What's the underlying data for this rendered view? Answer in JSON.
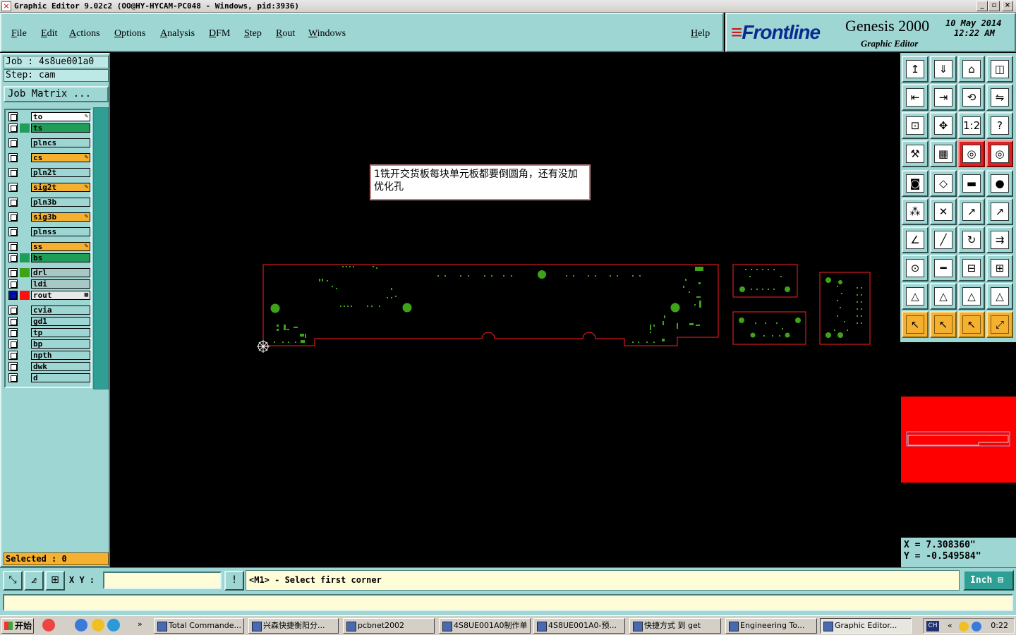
{
  "window": {
    "title": "Graphic Editor 9.02c2  (OO@HY-HYCAM-PC048 - Windows, pid:3936)"
  },
  "menu": {
    "items": [
      "File",
      "Edit",
      "Actions",
      "Options",
      "Analysis",
      "DFM",
      "Step",
      "Rout",
      "Windows"
    ],
    "help": "Help"
  },
  "brand": {
    "logo": "Frontline",
    "product": "Genesis 2000",
    "subtitle": "Graphic Editor",
    "date": "10 May 2014",
    "time": "12:22 AM"
  },
  "job": {
    "job_label": "Job : 4s8ue001a0",
    "step_label": "Step: cam",
    "matrix_button": "Job Matrix ..."
  },
  "layers": [
    {
      "name": "to",
      "color": "#ffffff",
      "marker": "✎"
    },
    {
      "name": "ts",
      "color": "#1f9e58",
      "marker": ""
    },
    {
      "name": "plncs",
      "color": "#9ed6d3",
      "marker": ""
    },
    {
      "name": "cs",
      "color": "#f5b030",
      "marker": "✎"
    },
    {
      "name": "pln2t",
      "color": "#9ed6d3",
      "marker": ""
    },
    {
      "name": "sig2t",
      "color": "#f5b030",
      "marker": "✎"
    },
    {
      "name": "pln3b",
      "color": "#9ed6d3",
      "marker": ""
    },
    {
      "name": "sig3b",
      "color": "#f5b030",
      "marker": "✎"
    },
    {
      "name": "plnss",
      "color": "#9ed6d3",
      "marker": ""
    },
    {
      "name": "ss",
      "color": "#f5b030",
      "marker": "✎"
    },
    {
      "name": "bs",
      "color": "#1f9e58",
      "marker": ""
    },
    {
      "name": "drl",
      "color": "#a8c8c6",
      "marker": ""
    },
    {
      "name": "ldi",
      "color": "#a8c8c6",
      "marker": ""
    },
    {
      "name": "rout",
      "color": "#e8e8e8",
      "marker": "▦"
    },
    {
      "name": "cvia",
      "color": "#9ed6d3",
      "marker": ""
    },
    {
      "name": "gd1",
      "color": "#9ed6d3",
      "marker": ""
    },
    {
      "name": "tp",
      "color": "#9ed6d3",
      "marker": ""
    },
    {
      "name": "bp",
      "color": "#9ed6d3",
      "marker": ""
    },
    {
      "name": "npth",
      "color": "#9ed6d3",
      "marker": ""
    },
    {
      "name": "dwk",
      "color": "#9ed6d3",
      "marker": ""
    },
    {
      "name": "d",
      "color": "#9ed6d3",
      "marker": ""
    }
  ],
  "selected_label": "Selected : 0",
  "note": "1铣开交货板每块单元板都要倒圆角，还有没加优化孔",
  "coords": {
    "x_label": "X  =  7.308360\"",
    "y_label": "Y  = -0.549584\""
  },
  "command": {
    "xy_label": "X Y :",
    "xy_value": "",
    "prompt": "<M1> - Select first corner",
    "unit": "Inch"
  },
  "taskbar": {
    "start": "开始",
    "tasks": [
      "Total Commande...",
      "兴森快捷衡阳分...",
      "pcbnet2002",
      "4S8UE001A0制作单",
      "4S8UE001A0-预...",
      "快捷方式 到 get",
      "Engineering To...",
      "Graphic Editor..."
    ],
    "lang": "CH",
    "clock": "0:22"
  },
  "colors": {
    "panel": "#9ed6d3",
    "highlight": "#f5b030",
    "rout_outline": "#ff2020",
    "pad_green": "#3fa31a"
  }
}
